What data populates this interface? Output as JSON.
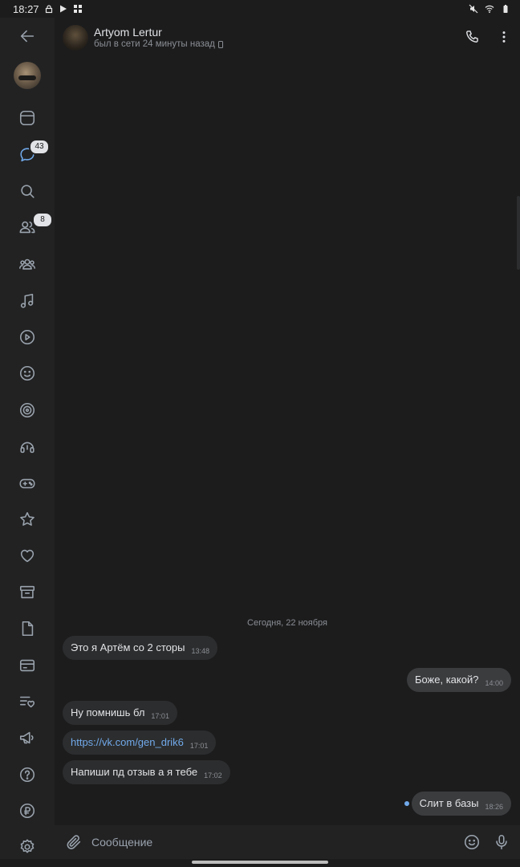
{
  "status_bar": {
    "time": "18:27"
  },
  "sidebar": {
    "messages_badge": "43",
    "friends_badge": "8",
    "items": [
      {
        "icon": "back-arrow-icon"
      },
      {
        "icon": "profile-avatar"
      },
      {
        "icon": "news-icon"
      },
      {
        "icon": "messages-icon"
      },
      {
        "icon": "search-icon"
      },
      {
        "icon": "friends-icon"
      },
      {
        "icon": "communities-icon"
      },
      {
        "icon": "music-icon"
      },
      {
        "icon": "video-icon"
      },
      {
        "icon": "stickers-icon"
      },
      {
        "icon": "target-icon"
      },
      {
        "icon": "podcasts-icon"
      },
      {
        "icon": "games-icon"
      },
      {
        "icon": "bookmarks-star-icon"
      },
      {
        "icon": "likes-heart-icon"
      },
      {
        "icon": "archive-icon"
      },
      {
        "icon": "documents-icon"
      },
      {
        "icon": "payments-card-icon"
      },
      {
        "icon": "wishlist-icon"
      },
      {
        "icon": "ads-megaphone-icon"
      },
      {
        "icon": "help-icon"
      },
      {
        "icon": "vk-pay-ruble-icon"
      },
      {
        "icon": "settings-gear-icon"
      }
    ]
  },
  "header": {
    "name": "Artyom Lertur",
    "status": "был в сети 24 минуты назад"
  },
  "chat": {
    "date_separator": "Сегодня, 22 ноября",
    "messages": [
      {
        "dir": "in",
        "text": "Это я Артём со 2 сторы",
        "time": "13:48"
      },
      {
        "dir": "out",
        "text": "Боже, какой?",
        "time": "14:00"
      },
      {
        "dir": "in",
        "text": "Ну помнишь бл",
        "time": "17:01"
      },
      {
        "dir": "in",
        "text": "https://vk.com/gen_drik6",
        "time": "17:01",
        "is_link": true
      },
      {
        "dir": "in",
        "text": "Напиши пд отзыв а я тебе",
        "time": "17:02"
      },
      {
        "dir": "out",
        "text": "Слит в базы",
        "time": "18:26",
        "unread": true
      }
    ]
  },
  "composer": {
    "placeholder": "Сообщение"
  },
  "colors": {
    "background": "#1c1c1d",
    "sidebar": "#222223",
    "bubble_in": "#2c2d2e",
    "bubble_out": "#3b3c3e",
    "link": "#71aaeb",
    "unread_dot": "#71aaeb"
  }
}
